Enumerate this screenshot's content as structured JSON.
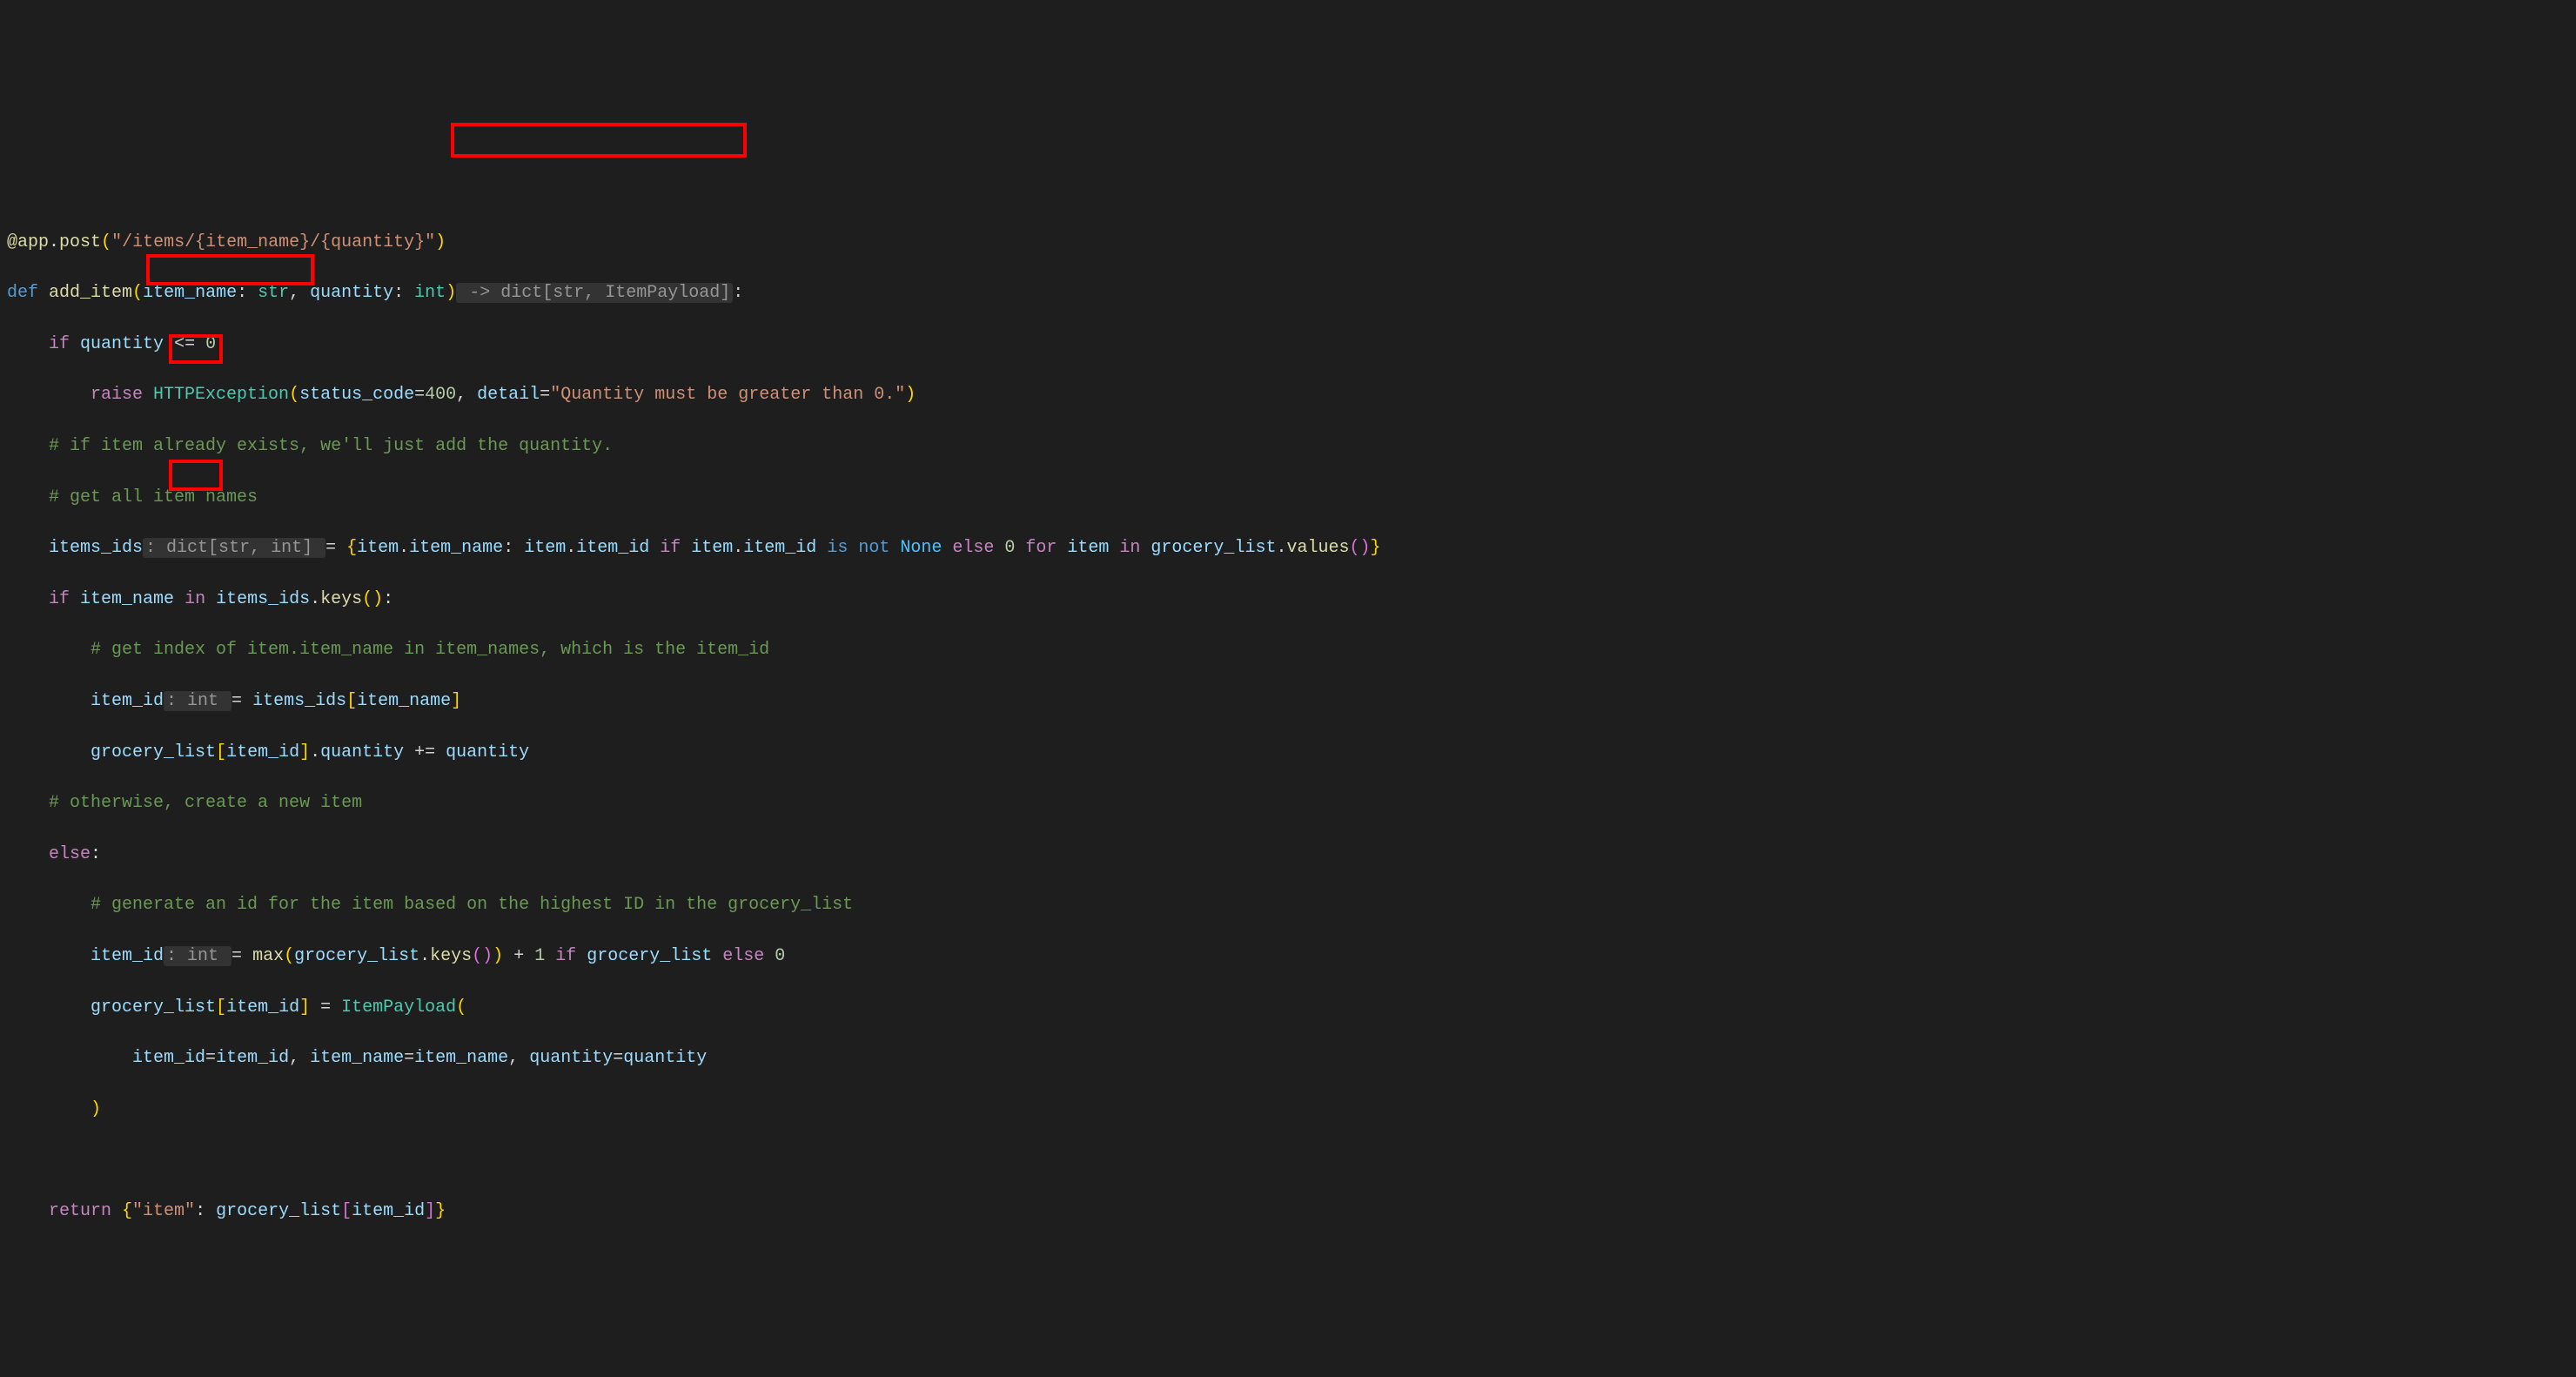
{
  "lines": {
    "l1_decorator": "@app",
    "l1_dot": ".",
    "l1_post": "post",
    "l1_open": "(",
    "l1_str": "\"/items/{item_name}/{quantity}\"",
    "l1_close": ")",
    "l2_def": "def",
    "l2_fn": " add_item",
    "l2_open": "(",
    "l2_p1": "item_name",
    "l2_c1": ": ",
    "l2_t1": "str",
    "l2_comma": ", ",
    "l2_p2": "quantity",
    "l2_c2": ": ",
    "l2_t2": "int",
    "l2_close": ")",
    "l2_inlay": " -> dict[str, ItemPayload]",
    "l2_colon": ":",
    "l3_if": "if",
    "l3_var": " quantity ",
    "l3_op": "<= ",
    "l3_num": "0",
    "l3_colon": ":",
    "l4_raise": "raise",
    "l4_exc": " HTTPException",
    "l4_open": "(",
    "l4_p1": "status_code",
    "l4_eq1": "=",
    "l4_n1": "400",
    "l4_comma": ", ",
    "l4_p2": "detail",
    "l4_eq2": "=",
    "l4_s1": "\"Quantity must be greater than 0.\"",
    "l4_close": ")",
    "l5_comment": "# if item already exists, we'll just add the quantity.",
    "l6_comment": "# get all item names",
    "l7_var": "items_ids",
    "l7_inlay": ": dict[str, int] ",
    "l7_eq": "= ",
    "l7_open": "{",
    "l7_item1": "item",
    "l7_dot1": ".",
    "l7_attr1": "item_name",
    "l7_colon": ": ",
    "l7_item2": "item",
    "l7_dot2": ".",
    "l7_attr2": "item_id",
    "l7_if": " if ",
    "l7_item3": "item",
    "l7_dot3": ".",
    "l7_attr3": "item_id",
    "l7_isnot": " is not ",
    "l7_none": "None",
    "l7_else": " else ",
    "l7_zero": "0",
    "l7_for": " for ",
    "l7_item4": "item",
    "l7_in": " in ",
    "l7_gl": "grocery_list",
    "l7_dot4": ".",
    "l7_values": "values",
    "l7_paren": "()",
    "l7_close": "}",
    "l8_if": "if",
    "l8_var": " item_name ",
    "l8_in": "in",
    "l8_ids": " items_ids",
    "l8_dot": ".",
    "l8_keys": "keys",
    "l8_paren": "()",
    "l8_colon": ":",
    "l9_comment": "# get index of item.item_name in item_names, which is the item_id",
    "l10_var": "item_id",
    "l10_inlay": ": int ",
    "l10_eq": "= ",
    "l10_ids": "items_ids",
    "l10_open": "[",
    "l10_name": "item_name",
    "l10_close": "]",
    "l11_gl": "grocery_list",
    "l11_open": "[",
    "l11_id": "item_id",
    "l11_close": "]",
    "l11_dot": ".",
    "l11_q": "quantity",
    "l11_op": " += ",
    "l11_qty": "quantity",
    "l12_comment": "# otherwise, create a new item",
    "l13_else": "else",
    "l13_colon": ":",
    "l14_comment": "# generate an id for the item based on the highest ID in the grocery_list",
    "l15_var": "item_id",
    "l15_inlay": ": int ",
    "l15_eq": "= ",
    "l15_max": "max",
    "l15_open": "(",
    "l15_gl": "grocery_list",
    "l15_dot": ".",
    "l15_keys": "keys",
    "l15_paren": "()",
    "l15_close": ")",
    "l15_plus": " + ",
    "l15_one": "1",
    "l15_if": " if ",
    "l15_gl2": "grocery_list",
    "l15_else": " else ",
    "l15_zero": "0",
    "l16_gl": "grocery_list",
    "l16_open": "[",
    "l16_id": "item_id",
    "l16_close": "]",
    "l16_eq": " = ",
    "l16_ip": "ItemPayload",
    "l16_paren": "(",
    "l17_p1": "item_id",
    "l17_eq1": "=",
    "l17_v1": "item_id",
    "l17_c1": ", ",
    "l17_p2": "item_name",
    "l17_eq2": "=",
    "l17_v2": "item_name",
    "l17_c2": ", ",
    "l17_p3": "quantity",
    "l17_eq3": "=",
    "l17_v3": "quantity",
    "l18_close": ")",
    "l20_return": "return",
    "l20_open": " {",
    "l20_str": "\"item\"",
    "l20_colon": ": ",
    "l20_gl": "grocery_list",
    "l20_bopen": "[",
    "l20_id": "item_id",
    "l20_bclose": "]",
    "l20_close": "}"
  }
}
